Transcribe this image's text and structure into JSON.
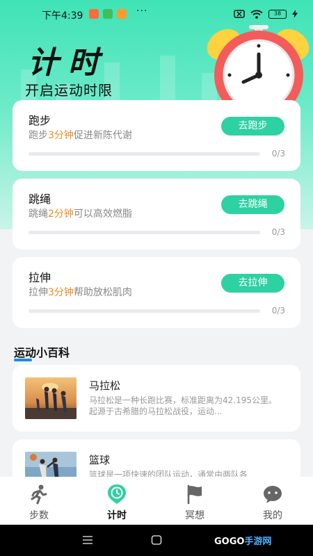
{
  "status_bar": {
    "time": "下午4:39",
    "more": "···",
    "battery": "38"
  },
  "header": {
    "title": "计时",
    "subtitle": "开启运动时限"
  },
  "cards": [
    {
      "title": "跑步",
      "desc_pre": "跑步",
      "desc_hl": "3分钟",
      "desc_post": "促进新陈代谢",
      "button": "去跑步",
      "progress": "0/3",
      "progress_fraction": 0
    },
    {
      "title": "跳绳",
      "desc_pre": "跳绳",
      "desc_hl": "2分钟",
      "desc_post": "可以高效燃脂",
      "button": "去跳绳",
      "progress": "0/3",
      "progress_fraction": 0
    },
    {
      "title": "拉伸",
      "desc_pre": "拉伸",
      "desc_hl": "3分钟",
      "desc_post": "帮助放松肌肉",
      "button": "去拉伸",
      "progress": "0/3",
      "progress_fraction": 0
    }
  ],
  "wiki": {
    "title": "运动小百科",
    "items": [
      {
        "title": "马拉松",
        "desc": "马拉松是一种长跑比赛，标准距离为42.195公里。起源于古希腊的马拉松战役，运动..."
      },
      {
        "title": "篮球",
        "desc": "篮球是一项快速的团队运动，通常由两队各"
      }
    ]
  },
  "tabs": [
    {
      "label": "步数",
      "icon": "runner-icon",
      "active": false
    },
    {
      "label": "计时",
      "icon": "clock-pin-icon",
      "active": true
    },
    {
      "label": "冥想",
      "icon": "flag-icon",
      "active": false
    },
    {
      "label": "我的",
      "icon": "chat-face-icon",
      "active": false
    }
  ],
  "watermark": {
    "brand": "GOGO",
    "suffix": "手游网"
  },
  "colors": {
    "accent": "#2ed1a2",
    "highlight": "#f08a24",
    "hero": "#3fe3b6"
  }
}
